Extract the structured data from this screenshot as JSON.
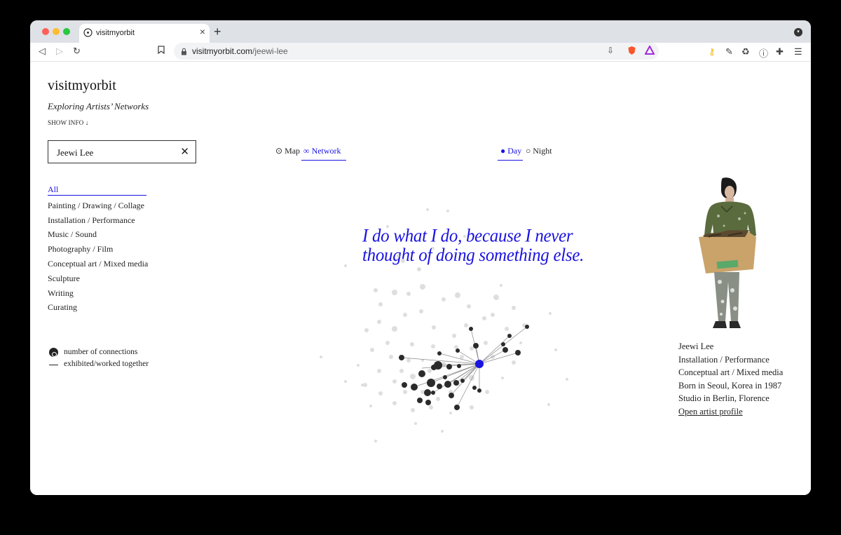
{
  "browser": {
    "tab_title": "visitmyorbit",
    "url_host": "visitmyorbit.com",
    "url_path": "/jeewi-lee"
  },
  "site": {
    "title": "visitmyorbit",
    "tagline": "Exploring Artists’ Networks",
    "show_info": "SHOW INFO ↓"
  },
  "search": {
    "value": "Jeewi Lee"
  },
  "categories": [
    "All",
    "Painting / Drawing / Collage",
    "Installation / Performance",
    "Music / Sound",
    "Photography / Film",
    "Conceptual art / Mixed media",
    "Sculpture",
    "Writing",
    "Curating"
  ],
  "legend": {
    "connections": "number of connections",
    "together": "exhibited/worked together"
  },
  "views": {
    "map": "Map",
    "network": "Network",
    "map_symbol": "⊙",
    "network_symbol": "∞"
  },
  "modes": {
    "day": "Day",
    "night": "Night"
  },
  "quote": "I do what I do, because I never thought of doing something else.",
  "artist": {
    "name": "Jeewi Lee",
    "discipline1": "Installation / Performance",
    "discipline2": "Conceptual art / Mixed media",
    "born": "Born in Seoul, Korea in 1987",
    "studio": "Studio in Berlin, Florence",
    "profile_link": "Open artist profile"
  },
  "colors": {
    "accent": "#1a12e0",
    "node_dark": "#2b2b2b",
    "node_light": "#dcdcdc"
  }
}
